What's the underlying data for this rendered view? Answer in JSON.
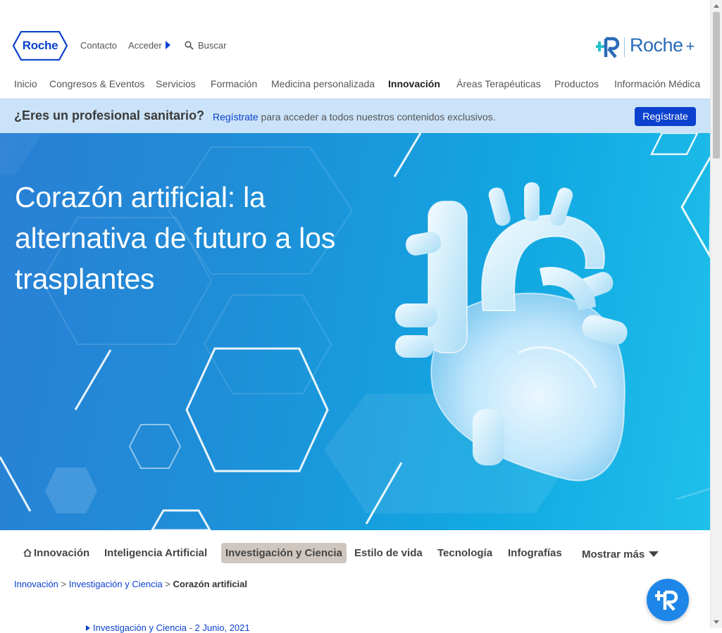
{
  "header": {
    "logo_text": "Roche",
    "contact": "Contacto",
    "login": "Acceder",
    "search": "Buscar",
    "roche_plus": "Roche",
    "roche_plus_suffix": "+"
  },
  "nav": {
    "items": [
      "Inicio",
      "Congresos & Eventos",
      "Servicios",
      "Formación",
      "Medicina personalizada",
      "Innovación",
      "Áreas Terapéuticas",
      "Productos",
      "Información Médica"
    ],
    "active": "Innovación"
  },
  "pro_banner": {
    "question": "¿Eres un profesional sanitario?",
    "link": "Regístrate",
    "message": " para acceder a todos nuestros contenidos exclusivos.",
    "button": "Regístrate"
  },
  "hero": {
    "title": "Corazón artificial: la alternativa de futuro a los trasplantes"
  },
  "subnav": {
    "home": "Innovación",
    "items": [
      "Inteligencia Artificial",
      "Investigación y Ciencia",
      "Estilo de vida",
      "Tecnología",
      "Infografías"
    ],
    "selected": "Investigación y Ciencia",
    "more": "Mostrar más"
  },
  "breadcrumb": {
    "items": [
      "Innovación",
      "Investigación y Ciencia"
    ],
    "separator": ">",
    "current": "Corazón artificial"
  },
  "article_meta": {
    "category": "Investigación y Ciencia",
    "date": "2 Junio, 2021"
  },
  "colors": {
    "brand_blue": "#0b41cd",
    "banner_bg": "#cbe3f8",
    "hero_start": "#2a7fd4",
    "hero_end": "#1ec0ea",
    "fab": "#1d86e8"
  }
}
